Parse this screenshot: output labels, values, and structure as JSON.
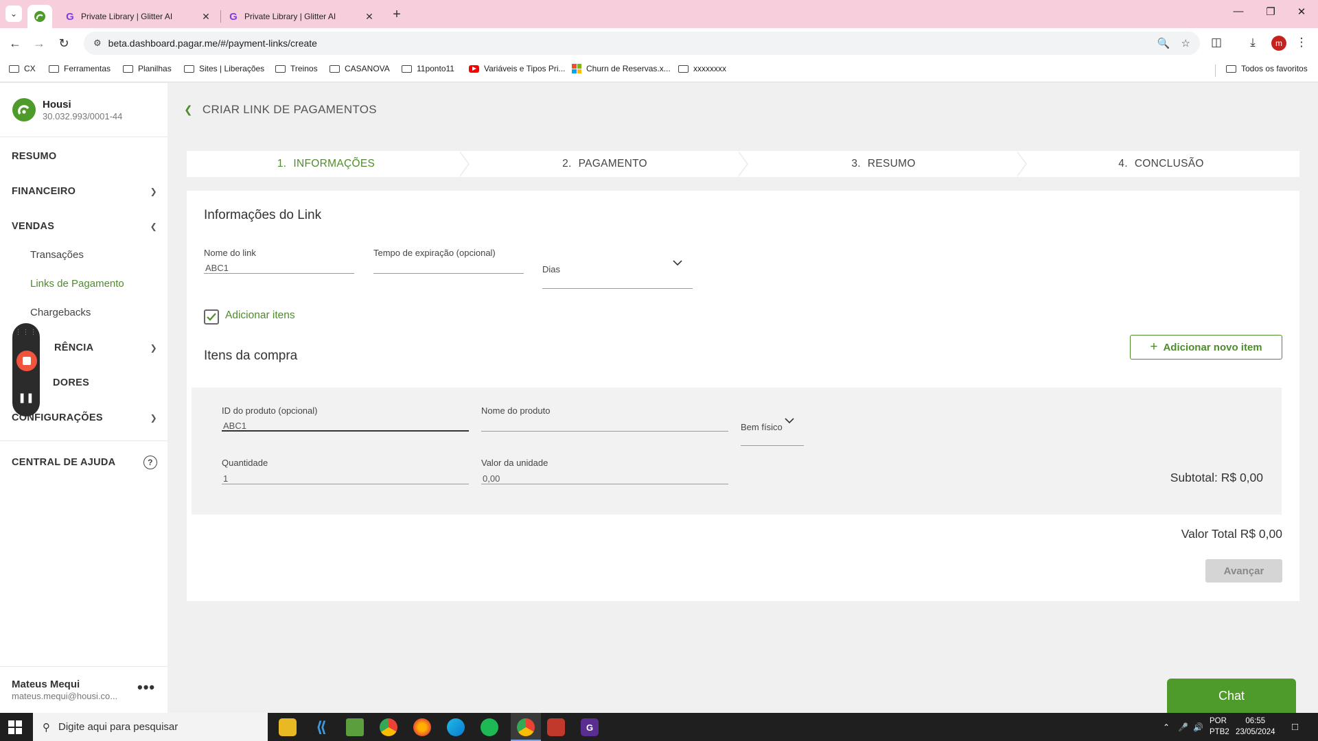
{
  "browser": {
    "tabs": [
      {
        "title": "Private Library | Glitter AI"
      },
      {
        "title": "Private Library | Glitter AI"
      }
    ],
    "url": "beta.dashboard.pagar.me/#/payment-links/create",
    "profile_initial": "m",
    "bookmarks": [
      {
        "label": "CX",
        "icon": "folder-icon"
      },
      {
        "label": "Ferramentas",
        "icon": "folder-icon"
      },
      {
        "label": "Planilhas",
        "icon": "folder-icon"
      },
      {
        "label": "Sites | Liberações",
        "icon": "folder-icon"
      },
      {
        "label": "Treinos",
        "icon": "folder-icon"
      },
      {
        "label": "CASANOVA",
        "icon": "folder-icon"
      },
      {
        "label": "11ponto11",
        "icon": "folder-icon"
      },
      {
        "label": "Variáveis e Tipos Pri...",
        "icon": "youtube-icon"
      },
      {
        "label": "Churn de Reservas.x...",
        "icon": "microsoft-icon"
      },
      {
        "label": "xxxxxxxx",
        "icon": "folder-icon"
      }
    ],
    "all_bookmarks": "Todos os favoritos"
  },
  "sidebar": {
    "company_name": "Housi",
    "company_cnpj": "30.032.993/0001-44",
    "resumo": "RESUMO",
    "financeiro": "FINANCEIRO",
    "vendas": "VENDAS",
    "vendas_items": [
      "Transações",
      "Links de Pagamento",
      "Chargebacks"
    ],
    "transferencia": "RÊNCIA",
    "recebedores": "DORES",
    "configuracoes": "CONFIGURAÇÕES",
    "central_ajuda": "CENTRAL DE AJUDA",
    "user_name": "Mateus Mequi",
    "user_email": "mateus.mequi@housi.co..."
  },
  "main": {
    "page_title": "CRIAR LINK DE PAGAMENTOS",
    "steps": [
      {
        "num": "1.",
        "label": "INFORMAÇÕES"
      },
      {
        "num": "2.",
        "label": "PAGAMENTO"
      },
      {
        "num": "3.",
        "label": "RESUMO"
      },
      {
        "num": "4.",
        "label": "CONCLUSÃO"
      }
    ],
    "section_info_title": "Informações do Link",
    "link_name_label": "Nome do link",
    "link_name_value": "ABC1",
    "expiration_label": "Tempo de expiração (opcional)",
    "expiration_value": "",
    "expiration_unit": "Dias",
    "add_items_label": "Adicionar itens",
    "add_items_checked": true,
    "section_items_title": "Itens da compra",
    "add_new_item_button": "Adicionar novo item",
    "item": {
      "product_id_label": "ID do produto (opcional)",
      "product_id_value": "ABC1",
      "product_name_label": "Nome do produto",
      "product_name_value": "",
      "product_type": "Bem físico",
      "quantity_label": "Quantidade",
      "quantity_value": "1",
      "unit_value_label": "Valor da unidade",
      "unit_value_value": "0,00",
      "subtotal": "Subtotal: R$ 0,00"
    },
    "total": "Valor Total R$ 0,00",
    "advance_button": "Avançar",
    "chat_button": "Chat"
  },
  "taskbar": {
    "search_placeholder": "Digite aqui para pesquisar",
    "lang_line1": "POR",
    "lang_line2": "PTB2",
    "time": "06:55",
    "date": "23/05/2024"
  },
  "colors": {
    "brand_green": "#4e8c2b",
    "tabbar_pink": "#f7cfdc",
    "chat_green": "#4e9a2a"
  }
}
